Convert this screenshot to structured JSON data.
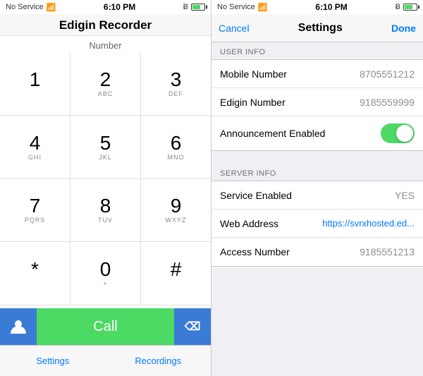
{
  "left": {
    "statusBar": {
      "noService": "No Service",
      "wifi": "wifi",
      "time": "6:10 PM",
      "bluetooth": "bluetooth",
      "battery": "battery"
    },
    "title": "Edigin Recorder",
    "numberLabel": "Number",
    "dialpad": [
      [
        {
          "digit": "1",
          "letters": ""
        },
        {
          "digit": "2",
          "letters": "ABC"
        },
        {
          "digit": "3",
          "letters": "DEF"
        }
      ],
      [
        {
          "digit": "4",
          "letters": "GHI"
        },
        {
          "digit": "5",
          "letters": "JKL"
        },
        {
          "digit": "6",
          "letters": "MNO"
        }
      ],
      [
        {
          "digit": "7",
          "letters": "PQRS"
        },
        {
          "digit": "8",
          "letters": "TUV"
        },
        {
          "digit": "9",
          "letters": "WXYZ"
        }
      ],
      [
        {
          "digit": "*",
          "letters": ""
        },
        {
          "digit": "0",
          "letters": "+"
        },
        {
          "digit": "#",
          "letters": ""
        }
      ]
    ],
    "callLabel": "Call",
    "tabs": [
      "Settings",
      "Recordings"
    ]
  },
  "right": {
    "statusBar": {
      "noService": "No Service",
      "wifi": "wifi",
      "time": "6:10 PM",
      "bluetooth": "bluetooth",
      "battery": "battery"
    },
    "nav": {
      "cancel": "Cancel",
      "title": "Settings",
      "done": "Done"
    },
    "userInfoHeader": "USER INFO",
    "serverInfoHeader": "SERVER INFO",
    "userInfoRows": [
      {
        "label": "Mobile Number",
        "value": "8705551212"
      },
      {
        "label": "Edigin Number",
        "value": "9185559999"
      },
      {
        "label": "Announcement Enabled",
        "value": "toggle_on"
      }
    ],
    "serverInfoRows": [
      {
        "label": "Service Enabled",
        "value": "YES"
      },
      {
        "label": "Web Address",
        "value": "https://svrxhosted.ed..."
      },
      {
        "label": "Access Number",
        "value": "9185551213"
      }
    ]
  }
}
